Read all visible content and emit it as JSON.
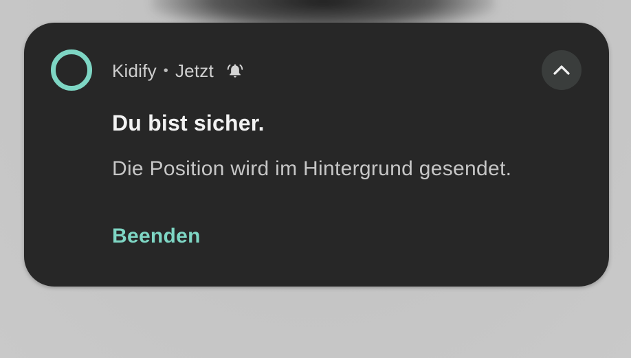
{
  "notification": {
    "app_name": "Kidify",
    "separator": "•",
    "time": "Jetzt",
    "title": "Du bist sicher.",
    "text": "Die Position wird im Hintergrund gesendet.",
    "action_label": "Beenden",
    "icons": {
      "app": "ring-icon",
      "alert": "bell-icon",
      "expand": "chevron-up-icon"
    },
    "colors": {
      "card_background": "#272727",
      "accent": "#7ed6c4"
    }
  }
}
